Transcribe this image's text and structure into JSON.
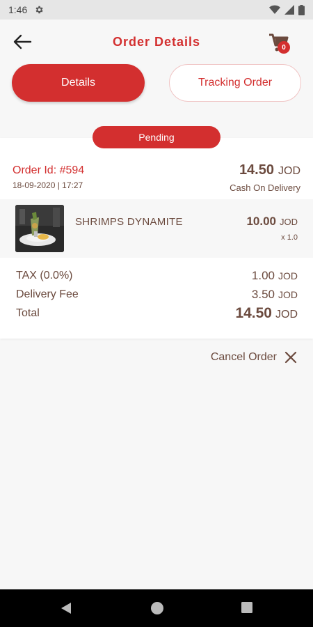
{
  "status_bar": {
    "time": "1:46",
    "icons": [
      "settings-icon",
      "wifi-icon",
      "signal-icon",
      "battery-icon"
    ]
  },
  "header": {
    "title": "Order Details",
    "cart_count": "0",
    "back_icon": "arrow-left-icon",
    "cart_icon": "cart-icon"
  },
  "tabs": [
    {
      "label": "Details",
      "active": true
    },
    {
      "label": "Tracking Order",
      "active": false
    }
  ],
  "status": "Pending",
  "order": {
    "id_label": "Order Id: #594",
    "date": "18-09-2020 | 17:27",
    "total": "14.50",
    "currency": "JOD",
    "payment_method": "Cash On Delivery"
  },
  "items": [
    {
      "name": "SHRIMPS DYNAMITE",
      "price": "10.00",
      "currency": "JOD",
      "qty": "x 1.0"
    }
  ],
  "summary": [
    {
      "label": "TAX (0.0%)",
      "value": "1.00",
      "currency": "JOD"
    },
    {
      "label": "Delivery Fee",
      "value": "3.50",
      "currency": "JOD"
    },
    {
      "label": "Total",
      "value": "14.50",
      "currency": "JOD"
    }
  ],
  "cancel": {
    "label": "Cancel Order",
    "icon": "close-icon"
  },
  "nav": [
    "back-icon",
    "home-icon",
    "recents-icon"
  ],
  "colors": {
    "accent": "#d32f2f",
    "text": "#6b4a3e",
    "background": "#f7f7f7"
  }
}
